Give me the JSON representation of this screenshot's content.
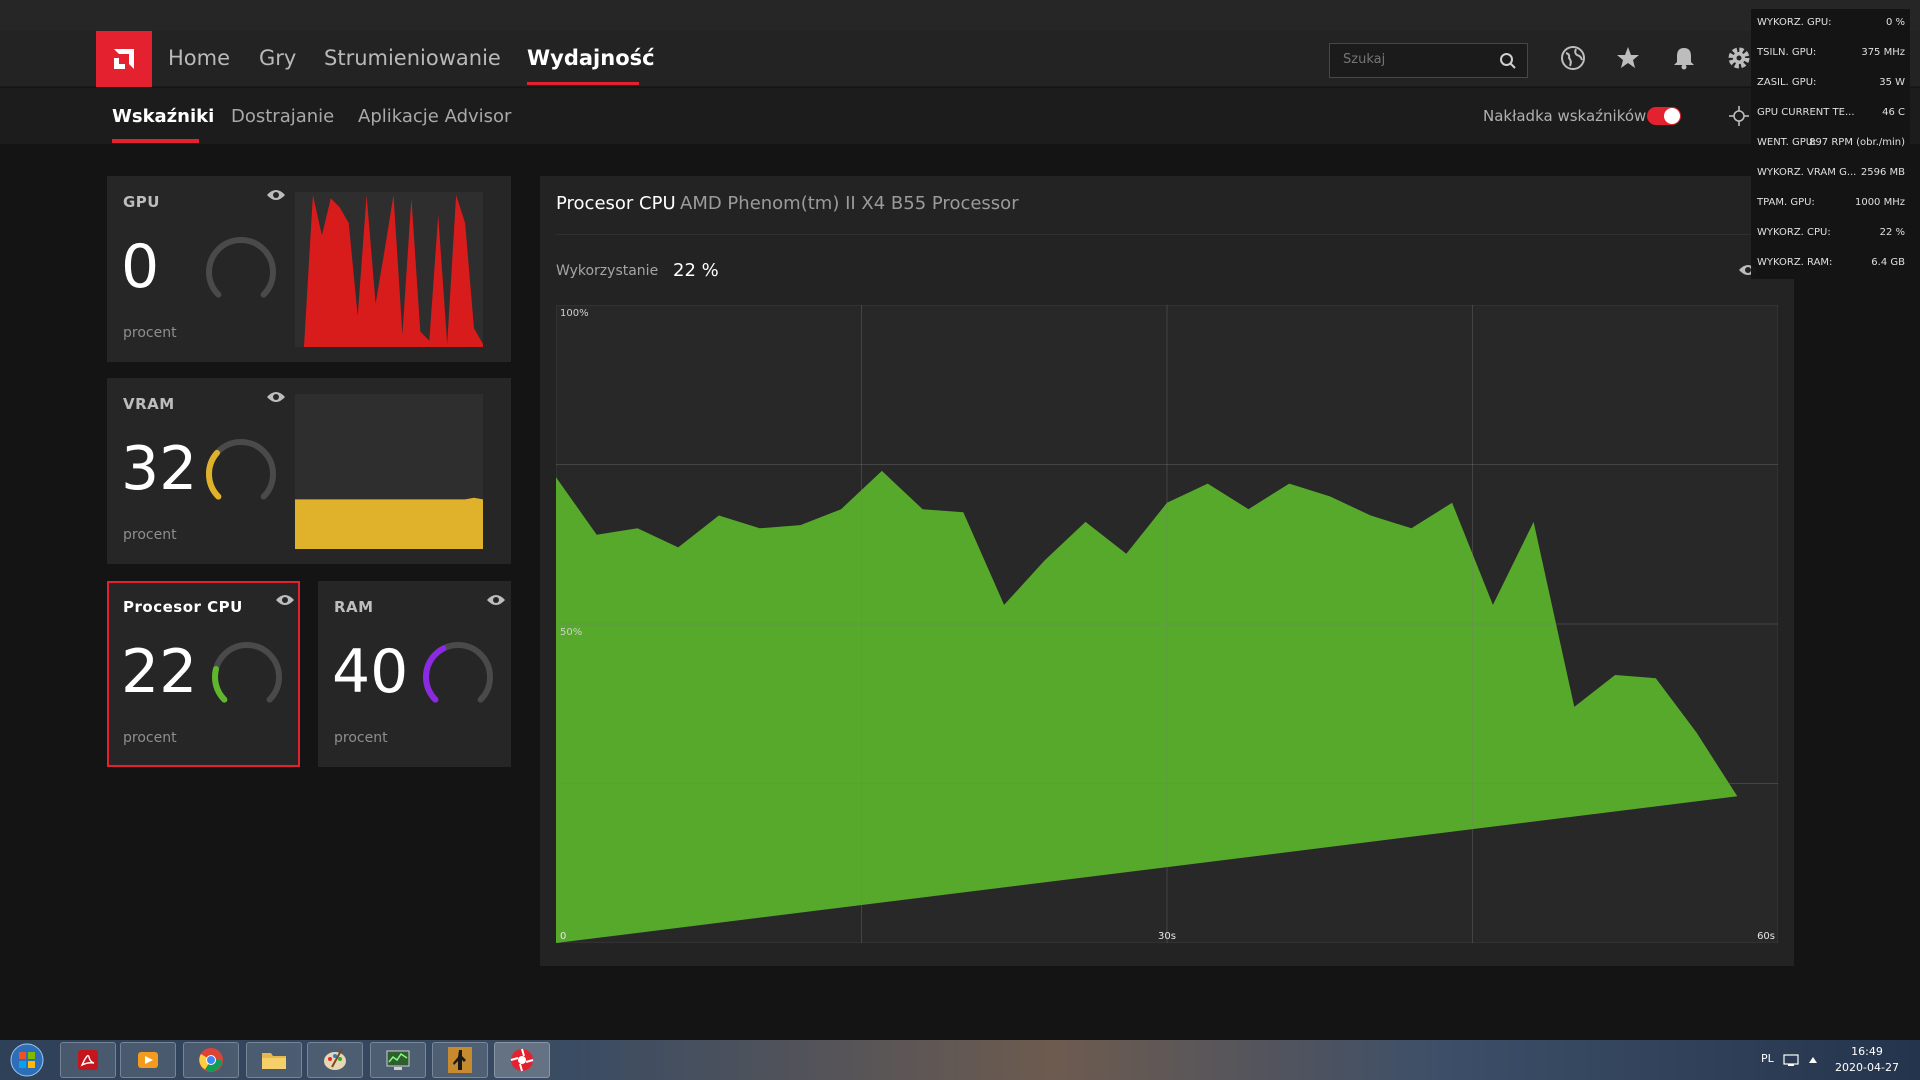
{
  "nav": {
    "items": [
      {
        "label": "Home",
        "active": false
      },
      {
        "label": "Gry",
        "active": false
      },
      {
        "label": "Strumieniowanie",
        "active": false
      },
      {
        "label": "Wydajność",
        "active": true
      }
    ],
    "search_placeholder": "Szukaj"
  },
  "subnav": {
    "items": [
      {
        "label": "Wskaźniki",
        "active": true
      },
      {
        "label": "Dostrajanie",
        "active": false
      },
      {
        "label": "Aplikacje Advisor",
        "active": false
      }
    ],
    "overlay_label": "Nakładka wskaźników",
    "overlay_enabled": true
  },
  "cards": {
    "gpu": {
      "title": "GPU",
      "value": "0",
      "unit": "procent",
      "percent": 0,
      "color": "#d81c1c"
    },
    "vram": {
      "title": "VRAM",
      "value": "32",
      "unit": "procent",
      "percent": 32,
      "color": "#e0b12a"
    },
    "cpu": {
      "title": "Procesor CPU",
      "value": "22",
      "unit": "procent",
      "percent": 22,
      "color": "#5fb82c"
    },
    "ram": {
      "title": "RAM",
      "value": "40",
      "unit": "procent",
      "percent": 40,
      "color": "#8a2be2"
    }
  },
  "sparklines": {
    "gpu": [
      0,
      0,
      98,
      72,
      96,
      90,
      80,
      20,
      98,
      28,
      62,
      98,
      8,
      96,
      10,
      4,
      85,
      2,
      98,
      80,
      12,
      2
    ],
    "vram": [
      32,
      32,
      32,
      32,
      32,
      32,
      32,
      32,
      32,
      32,
      32,
      32,
      32,
      32,
      32,
      32,
      32,
      32,
      32,
      32,
      33,
      32
    ]
  },
  "main": {
    "title": "Procesor CPU",
    "subtitle": "AMD Phenom(tm) II X4 B55 Processor",
    "usage_label": "Wykorzystanie",
    "usage_value": "22 %"
  },
  "chart_data": {
    "type": "area",
    "title": "Procesor CPU",
    "x": [
      0,
      2,
      4,
      6,
      8,
      10,
      12,
      14,
      16,
      18,
      20,
      22,
      24,
      26,
      28,
      30,
      32,
      34,
      36,
      38,
      40,
      42,
      44,
      46,
      48,
      50,
      52,
      54,
      56,
      58,
      60
    ],
    "series": [
      {
        "name": "",
        "values": [
          73,
          64,
          65,
          62,
          67,
          65,
          65.5,
          68,
          74,
          68,
          67.5,
          53,
          60,
          66,
          61,
          69,
          72,
          68,
          72,
          70,
          67,
          65,
          69,
          53,
          66,
          37,
          42,
          41.5,
          33,
          23
        ]
      }
    ],
    "x_tick_labels": [
      "0",
      "30s",
      "60s"
    ],
    "y_tick_labels": [
      "100%",
      "50%"
    ],
    "xlim": [
      0,
      60
    ],
    "ylim": [
      0,
      100
    ],
    "grid": true,
    "color": "#57a92c"
  },
  "overlay": {
    "rows": [
      {
        "key": "WYKORZ. GPU:",
        "value": "0 %"
      },
      {
        "key": "TSILN. GPU:",
        "value": "375 MHz"
      },
      {
        "key": "ZASIL. GPU:",
        "value": "35 W"
      },
      {
        "key": "GPU CURRENT TE...",
        "value": "46 C"
      },
      {
        "key": "WENT. GPU:",
        "value": "897 RPM (obr./min)"
      },
      {
        "key": "WYKORZ. VRAM G...",
        "value": "2596 MB"
      },
      {
        "key": "TPAM. GPU:",
        "value": "1000 MHz"
      },
      {
        "key": "WYKORZ. CPU:",
        "value": "22 %"
      },
      {
        "key": "WYKORZ. RAM:",
        "value": "6.4 GB"
      }
    ]
  },
  "taskbar": {
    "apps": [
      "acrobat-reader",
      "media-player",
      "chrome",
      "file-explorer",
      "paint",
      "system-monitor",
      "counter-strike",
      "amd-radeon"
    ],
    "language": "PL",
    "time": "16:49",
    "date": "2020-04-27"
  }
}
